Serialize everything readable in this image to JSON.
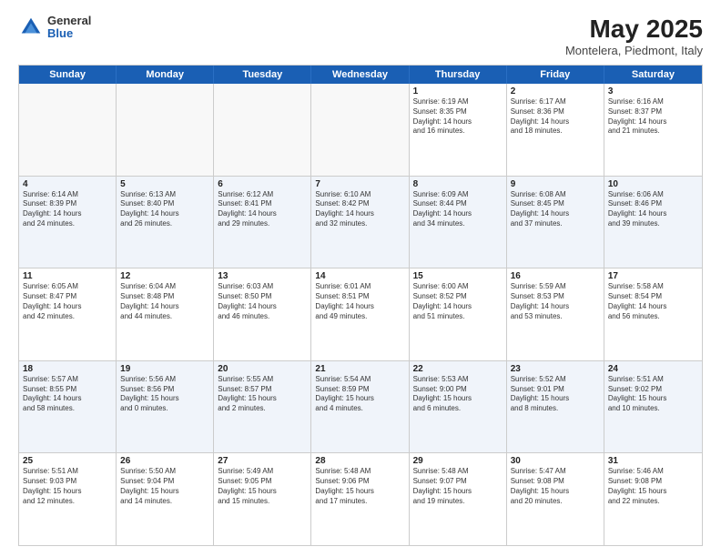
{
  "header": {
    "logo_general": "General",
    "logo_blue": "Blue",
    "month_title": "May 2025",
    "location": "Montelera, Piedmont, Italy"
  },
  "day_names": [
    "Sunday",
    "Monday",
    "Tuesday",
    "Wednesday",
    "Thursday",
    "Friday",
    "Saturday"
  ],
  "weeks": [
    [
      {
        "num": "",
        "info": "",
        "empty": true
      },
      {
        "num": "",
        "info": "",
        "empty": true
      },
      {
        "num": "",
        "info": "",
        "empty": true
      },
      {
        "num": "",
        "info": "",
        "empty": true
      },
      {
        "num": "1",
        "info": "Sunrise: 6:19 AM\nSunset: 8:35 PM\nDaylight: 14 hours\nand 16 minutes."
      },
      {
        "num": "2",
        "info": "Sunrise: 6:17 AM\nSunset: 8:36 PM\nDaylight: 14 hours\nand 18 minutes."
      },
      {
        "num": "3",
        "info": "Sunrise: 6:16 AM\nSunset: 8:37 PM\nDaylight: 14 hours\nand 21 minutes."
      }
    ],
    [
      {
        "num": "4",
        "info": "Sunrise: 6:14 AM\nSunset: 8:39 PM\nDaylight: 14 hours\nand 24 minutes."
      },
      {
        "num": "5",
        "info": "Sunrise: 6:13 AM\nSunset: 8:40 PM\nDaylight: 14 hours\nand 26 minutes."
      },
      {
        "num": "6",
        "info": "Sunrise: 6:12 AM\nSunset: 8:41 PM\nDaylight: 14 hours\nand 29 minutes."
      },
      {
        "num": "7",
        "info": "Sunrise: 6:10 AM\nSunset: 8:42 PM\nDaylight: 14 hours\nand 32 minutes."
      },
      {
        "num": "8",
        "info": "Sunrise: 6:09 AM\nSunset: 8:44 PM\nDaylight: 14 hours\nand 34 minutes."
      },
      {
        "num": "9",
        "info": "Sunrise: 6:08 AM\nSunset: 8:45 PM\nDaylight: 14 hours\nand 37 minutes."
      },
      {
        "num": "10",
        "info": "Sunrise: 6:06 AM\nSunset: 8:46 PM\nDaylight: 14 hours\nand 39 minutes."
      }
    ],
    [
      {
        "num": "11",
        "info": "Sunrise: 6:05 AM\nSunset: 8:47 PM\nDaylight: 14 hours\nand 42 minutes."
      },
      {
        "num": "12",
        "info": "Sunrise: 6:04 AM\nSunset: 8:48 PM\nDaylight: 14 hours\nand 44 minutes."
      },
      {
        "num": "13",
        "info": "Sunrise: 6:03 AM\nSunset: 8:50 PM\nDaylight: 14 hours\nand 46 minutes."
      },
      {
        "num": "14",
        "info": "Sunrise: 6:01 AM\nSunset: 8:51 PM\nDaylight: 14 hours\nand 49 minutes."
      },
      {
        "num": "15",
        "info": "Sunrise: 6:00 AM\nSunset: 8:52 PM\nDaylight: 14 hours\nand 51 minutes."
      },
      {
        "num": "16",
        "info": "Sunrise: 5:59 AM\nSunset: 8:53 PM\nDaylight: 14 hours\nand 53 minutes."
      },
      {
        "num": "17",
        "info": "Sunrise: 5:58 AM\nSunset: 8:54 PM\nDaylight: 14 hours\nand 56 minutes."
      }
    ],
    [
      {
        "num": "18",
        "info": "Sunrise: 5:57 AM\nSunset: 8:55 PM\nDaylight: 14 hours\nand 58 minutes."
      },
      {
        "num": "19",
        "info": "Sunrise: 5:56 AM\nSunset: 8:56 PM\nDaylight: 15 hours\nand 0 minutes."
      },
      {
        "num": "20",
        "info": "Sunrise: 5:55 AM\nSunset: 8:57 PM\nDaylight: 15 hours\nand 2 minutes."
      },
      {
        "num": "21",
        "info": "Sunrise: 5:54 AM\nSunset: 8:59 PM\nDaylight: 15 hours\nand 4 minutes."
      },
      {
        "num": "22",
        "info": "Sunrise: 5:53 AM\nSunset: 9:00 PM\nDaylight: 15 hours\nand 6 minutes."
      },
      {
        "num": "23",
        "info": "Sunrise: 5:52 AM\nSunset: 9:01 PM\nDaylight: 15 hours\nand 8 minutes."
      },
      {
        "num": "24",
        "info": "Sunrise: 5:51 AM\nSunset: 9:02 PM\nDaylight: 15 hours\nand 10 minutes."
      }
    ],
    [
      {
        "num": "25",
        "info": "Sunrise: 5:51 AM\nSunset: 9:03 PM\nDaylight: 15 hours\nand 12 minutes."
      },
      {
        "num": "26",
        "info": "Sunrise: 5:50 AM\nSunset: 9:04 PM\nDaylight: 15 hours\nand 14 minutes."
      },
      {
        "num": "27",
        "info": "Sunrise: 5:49 AM\nSunset: 9:05 PM\nDaylight: 15 hours\nand 15 minutes."
      },
      {
        "num": "28",
        "info": "Sunrise: 5:48 AM\nSunset: 9:06 PM\nDaylight: 15 hours\nand 17 minutes."
      },
      {
        "num": "29",
        "info": "Sunrise: 5:48 AM\nSunset: 9:07 PM\nDaylight: 15 hours\nand 19 minutes."
      },
      {
        "num": "30",
        "info": "Sunrise: 5:47 AM\nSunset: 9:08 PM\nDaylight: 15 hours\nand 20 minutes."
      },
      {
        "num": "31",
        "info": "Sunrise: 5:46 AM\nSunset: 9:08 PM\nDaylight: 15 hours\nand 22 minutes."
      }
    ]
  ]
}
